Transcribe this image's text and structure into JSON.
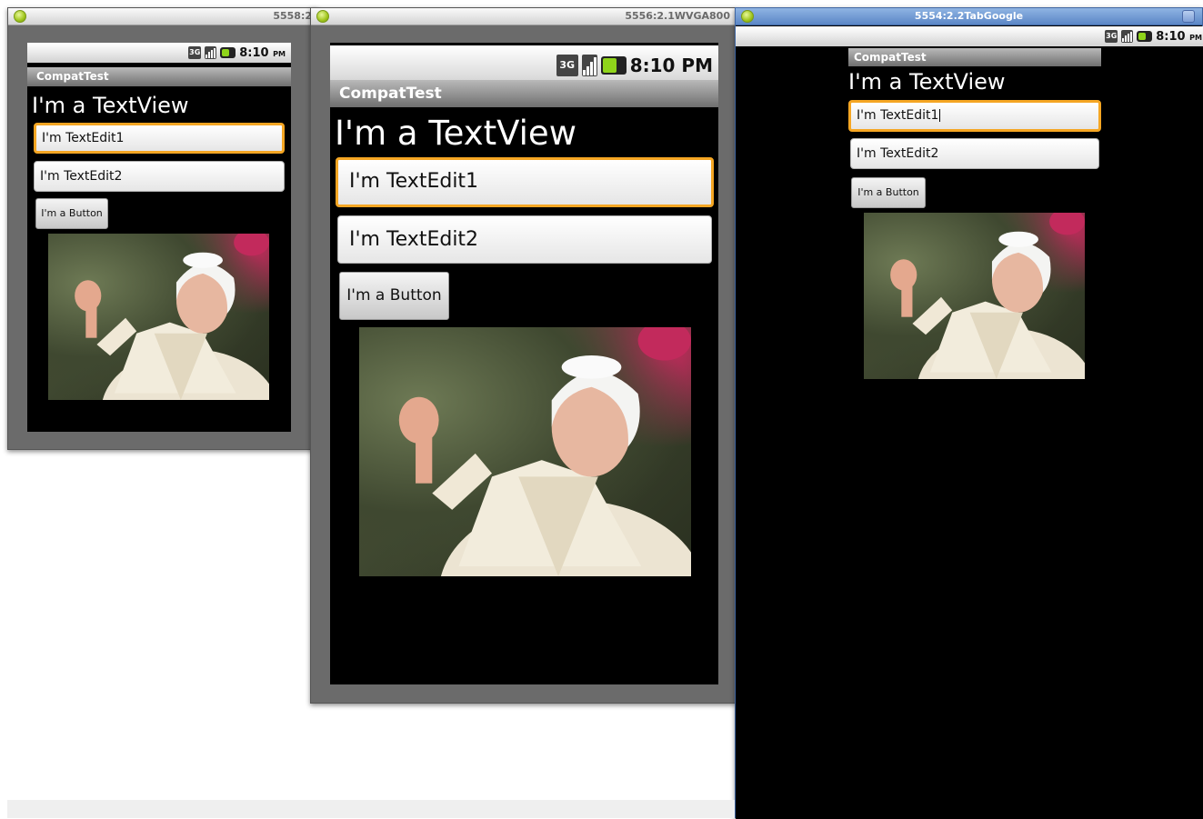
{
  "windows": [
    {
      "id": "left",
      "title": "5558:2",
      "status_time": "8:10",
      "status_ampm": "PM",
      "app_title": "CompatTest",
      "textview": "I'm a TextView",
      "edit1": "I'm TextEdit1",
      "edit2": "I'm TextEdit2",
      "button": "I'm a Button"
    },
    {
      "id": "middle",
      "title": "5556:2.1WVGA800",
      "status_time": "8:10 PM",
      "app_title": "CompatTest",
      "textview": "I'm a TextView",
      "edit1": "I'm TextEdit1",
      "edit2": "I'm TextEdit2",
      "button": "I'm a Button"
    },
    {
      "id": "right",
      "title": "5554:2.2TabGoogle",
      "status_time": "8:10",
      "status_ampm": "PM",
      "app_title": "CompatTest",
      "textview": "I'm a TextView",
      "edit1": "I'm TextEdit1",
      "edit2": "I'm TextEdit2",
      "button": "I'm a Button"
    }
  ],
  "icons": [
    "android-icon",
    "network-3g-icon",
    "signal-icon",
    "battery-icon",
    "minimize-icon",
    "close-icon"
  ],
  "colors": {
    "focus_border": "#f5a623",
    "screen_bg": "#000000",
    "active_titlebar": "#6f96d0"
  }
}
